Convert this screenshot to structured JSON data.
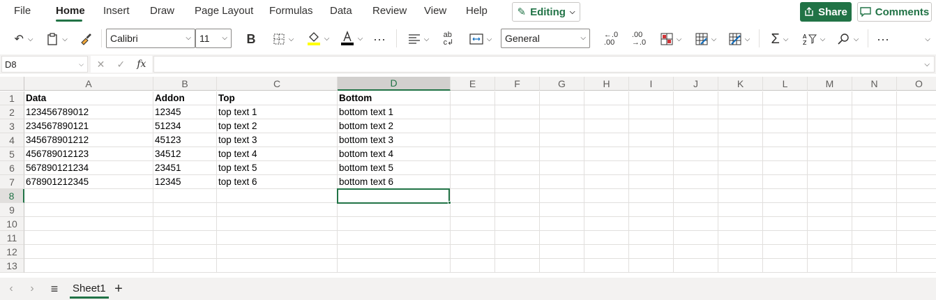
{
  "menu": {
    "tabs": [
      "File",
      "Home",
      "Insert",
      "Draw",
      "Page Layout",
      "Formulas",
      "Data",
      "Review",
      "View",
      "Help"
    ],
    "active_tab": "Home",
    "editing_label": "Editing",
    "share_label": "Share",
    "comments_label": "Comments"
  },
  "ribbon": {
    "font_name": "Calibri",
    "font_size": "11",
    "number_format": "General",
    "bold_label": "B"
  },
  "formula_bar": {
    "name_box": "D8",
    "fx_label": "fx",
    "formula": ""
  },
  "grid": {
    "columns": [
      "A",
      "B",
      "C",
      "D",
      "E",
      "F",
      "G",
      "H",
      "I",
      "J",
      "K",
      "L",
      "M",
      "N",
      "O"
    ],
    "selected_column": "D",
    "rows": [
      "1",
      "2",
      "3",
      "4",
      "5",
      "6",
      "7",
      "8",
      "9",
      "10",
      "11",
      "12",
      "13"
    ],
    "selected_row": "8",
    "selected_cell": "D8",
    "cells": [
      [
        "Data",
        "Addon",
        "Top",
        "Bottom"
      ],
      [
        "123456789012",
        "12345",
        "top text 1",
        "bottom text 1"
      ],
      [
        "234567890121",
        "51234",
        "top text 2",
        "bottom text 2"
      ],
      [
        "345678901212",
        "45123",
        "top text 3",
        "bottom text 3"
      ],
      [
        "456789012123",
        "34512",
        "top text 4",
        "bottom text 4"
      ],
      [
        "567890121234",
        "23451",
        "top text 5",
        "bottom text 5"
      ],
      [
        "678901212345",
        "12345",
        "top text 6",
        "bottom text 6"
      ]
    ]
  },
  "sheets": {
    "tabs": [
      "Sheet1"
    ],
    "active": "Sheet1",
    "add_label": "+"
  },
  "colors": {
    "accent": "#217346",
    "header_bg": "#f3f2f1",
    "gridline": "#e1dfdd"
  }
}
